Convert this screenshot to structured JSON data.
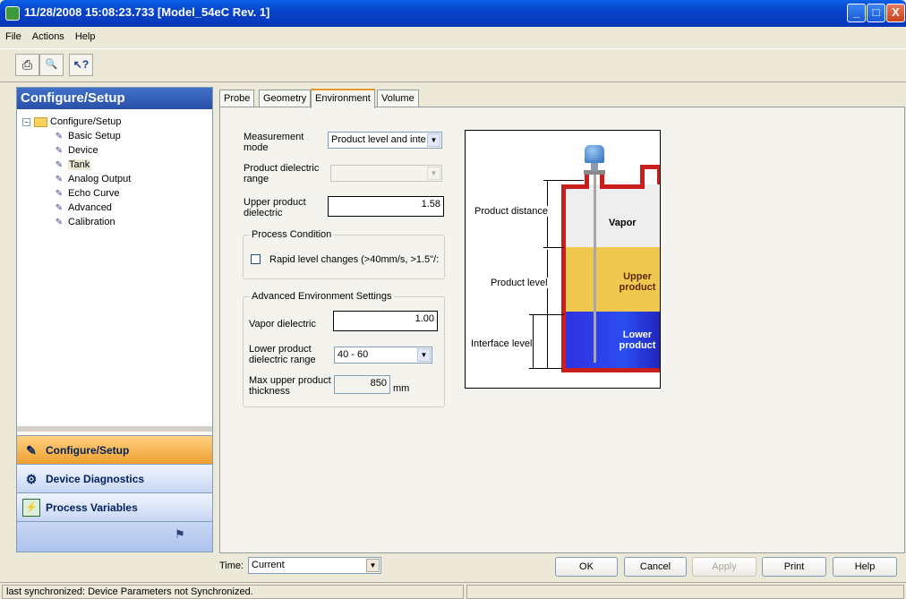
{
  "window": {
    "title": "11/28/2008 15:08:23.733 [Model_54eC Rev. 1]",
    "caption_buttons": {
      "minimize": "_",
      "maximize": "□",
      "close": "X"
    }
  },
  "menu": [
    "File",
    "Actions",
    "Help"
  ],
  "toolbar": {
    "icons": [
      "print-icon",
      "print-preview-icon",
      "help-pointer-icon"
    ],
    "glyphs": [
      "⎙",
      "🔍",
      "↖?"
    ]
  },
  "left_panel": {
    "header": "Configure/Setup",
    "tree": [
      {
        "label": "Configure/Setup",
        "icon": "folder-icon"
      },
      {
        "label": "Basic Setup",
        "icon": "wrench-icon"
      },
      {
        "label": "Device",
        "icon": "wrench-icon"
      },
      {
        "label": "Tank",
        "icon": "wrench-icon"
      },
      {
        "label": "Analog Output",
        "icon": "wrench-icon"
      },
      {
        "label": "Echo Curve",
        "icon": "wrench-icon"
      },
      {
        "label": "Advanced",
        "icon": "wrench-icon"
      },
      {
        "label": "Calibration",
        "icon": "wrench-icon"
      }
    ],
    "nav": [
      {
        "label": "Configure/Setup",
        "icon": "configure-icon",
        "active": true
      },
      {
        "label": "Device Diagnostics",
        "icon": "diagnostics-icon",
        "active": false
      },
      {
        "label": "Process Variables",
        "icon": "process-variables-icon",
        "active": false
      }
    ]
  },
  "tabs": [
    "Probe",
    "Geometry",
    "Environment",
    "Volume"
  ],
  "active_tab": "Environment",
  "form": {
    "measurement_mode_label": "Measurement mode",
    "measurement_mode_value": "Product level and inte",
    "product_dielectric_range_label": "Product dielectric range",
    "product_dielectric_range_value": "",
    "upper_product_dielectric_label": "Upper product dielectric",
    "upper_product_dielectric_value": "1.58",
    "process_condition": {
      "title": "Process Condition",
      "rapid_level_label": "Rapid level changes (>40mm/s, >1.5\"/:",
      "rapid_level_checked": false
    },
    "advanced_env": {
      "title": "Advanced Environment Settings",
      "vapor_dielectric_label": "Vapor dielectric",
      "vapor_dielectric_value": "1.00",
      "lower_product_range_label": "Lower product dielectric range",
      "lower_product_range_value": "40 - 60",
      "max_upper_thickness_label": "Max upper product thickness",
      "max_upper_thickness_value": "850",
      "max_upper_thickness_unit": "mm"
    }
  },
  "diagram": {
    "product_distance": "Product distance",
    "product_level": "Product level",
    "interface_level": "Interface level",
    "vapor": "Vapor",
    "upper_product": "Upper product",
    "lower_product": "Lower product",
    "colors": {
      "vapor": "#EEEEEE",
      "upper": "#F0C850",
      "lower": "#3030E0",
      "tank": "#C81E1E"
    }
  },
  "bottom": {
    "time_label": "Time:",
    "time_value": "Current",
    "buttons": {
      "ok": "OK",
      "cancel": "Cancel",
      "apply": "Apply",
      "print": "Print",
      "help": "Help"
    }
  },
  "status": {
    "message": "last synchronized: Device Parameters not Synchronized."
  }
}
